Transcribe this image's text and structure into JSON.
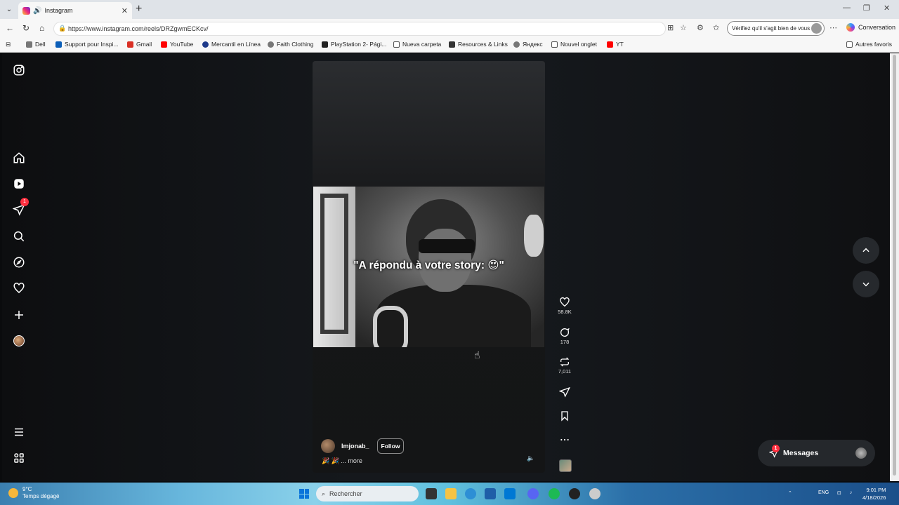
{
  "browser": {
    "tab_title": "Instagram",
    "url": "https://www.instagram.com/reels/DRZgwmECKcv/",
    "verify_text": "Vérifiez qu'il s'agit bien de vous",
    "conversation_label": "Conversation",
    "bookmarks": [
      {
        "label": "Dell",
        "color": "#555555"
      },
      {
        "label": "Support pour Inspi...",
        "color": "#0b5eb8"
      },
      {
        "label": "Gmail",
        "color": "#d93025"
      },
      {
        "label": "YouTube",
        "color": "#ff0000"
      },
      {
        "label": "Mercantil en Línea",
        "color": "#1e3a8a"
      },
      {
        "label": "Faith Clothing",
        "color": "#555555"
      },
      {
        "label": "PlayStation 2- Pági...",
        "color": "#222222"
      },
      {
        "label": "Nueva carpeta",
        "color": "#555555"
      },
      {
        "label": "Resources & Links",
        "color": "#333333"
      },
      {
        "label": "Яндекс",
        "color": "#555555"
      },
      {
        "label": "Nouvel onglet",
        "color": "#555555"
      },
      {
        "label": "YT",
        "color": "#ff0000"
      }
    ],
    "other_favorites": "Autres favoris"
  },
  "sidebar": {
    "notifications_badge": "1"
  },
  "reel": {
    "overlay_text": "\"A répondu à votre story: 😍\"",
    "username": "lmjonab_",
    "follow_label": "Follow",
    "caption_more": "🎉 🎉 ... more",
    "likes": "58.8K",
    "comments": "178",
    "reposts": "7,011"
  },
  "messages": {
    "label": "Messages",
    "badge": "1"
  },
  "taskbar": {
    "temp": "9°C",
    "weather": "Temps dégagé",
    "search_placeholder": "Rechercher",
    "lang": "ENG",
    "time": "9:01 PM",
    "date": "4/18/2026"
  },
  "colors": {
    "badge_red": "#ff3040",
    "page_bg": "#15181c"
  }
}
